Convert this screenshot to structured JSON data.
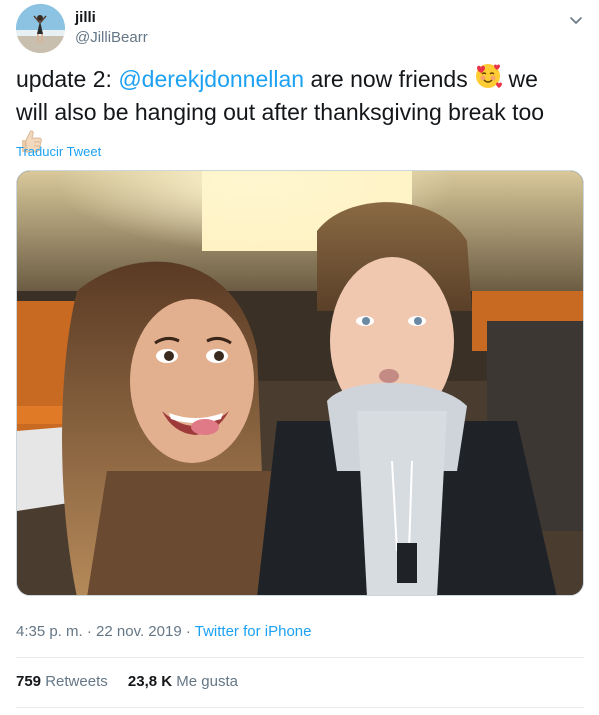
{
  "user": {
    "display_name": "jilli",
    "handle": "@JilliBearr"
  },
  "tweet": {
    "text_part1": "update 2: ",
    "mention": "@derekjdonnellan",
    "text_part2": " are now friends ",
    "text_part3": " we will also be hanging out after thanksgiving break too ",
    "emoji_1": "smiling-face-with-hearts",
    "emoji_2": "thumbs-up-light-skin"
  },
  "translate_label": "Traducir Tweet",
  "meta": {
    "time": "4:35 p. m.",
    "separator": " · ",
    "date": "22 nov. 2019",
    "source": "Twitter for iPhone"
  },
  "stats": {
    "retweets_count": "759",
    "retweets_label": "Retweets",
    "likes_count": "23,8 K",
    "likes_label": "Me gusta"
  },
  "colors": {
    "link": "#1da1f2",
    "secondary_text": "#657786",
    "primary_text": "#14171a",
    "divider": "#e6ecf0"
  }
}
